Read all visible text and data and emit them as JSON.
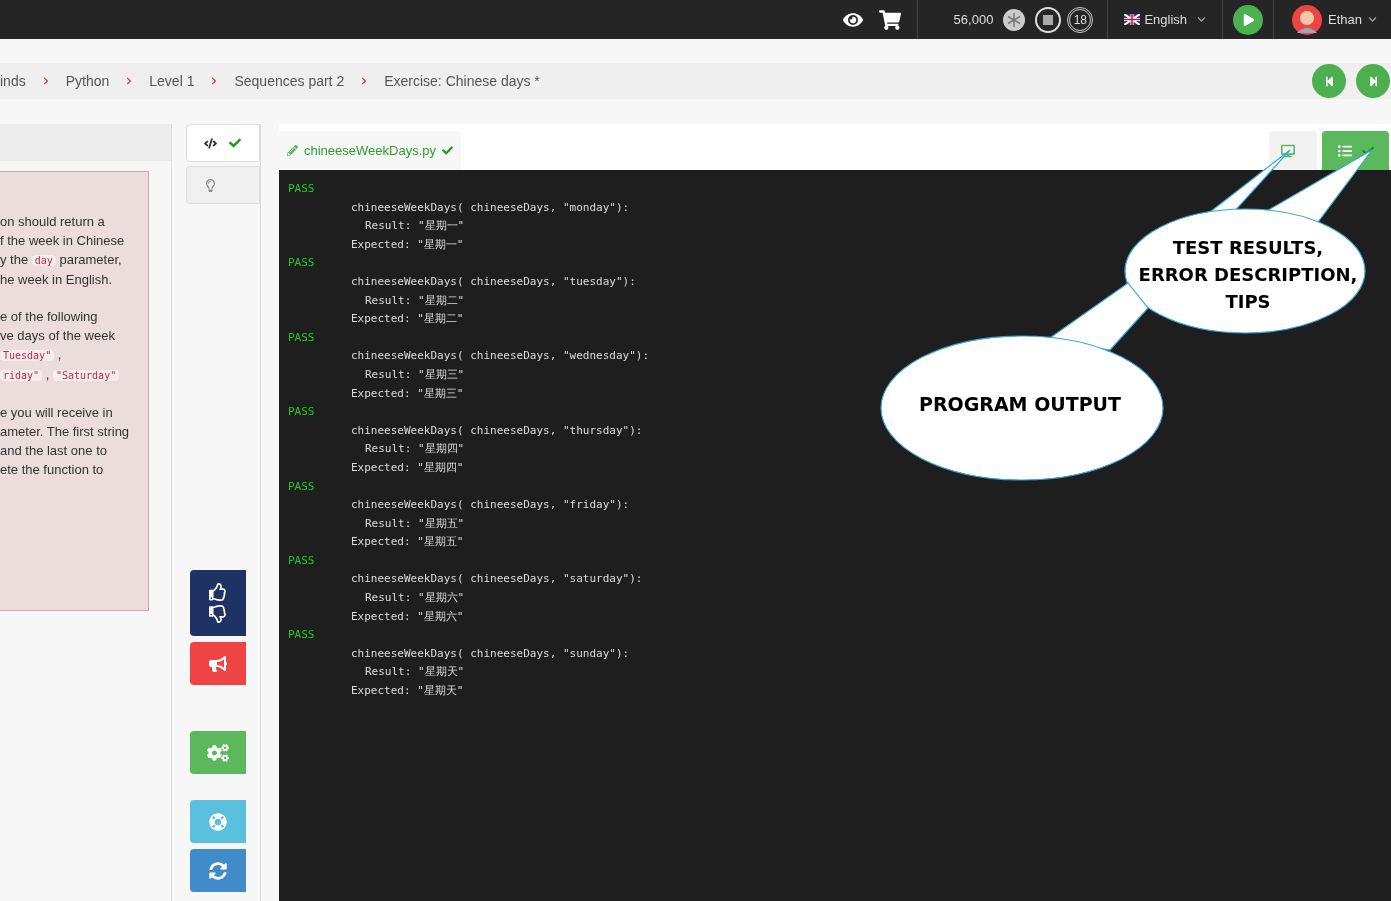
{
  "topbar": {
    "points": "56,000",
    "badge_count": "18",
    "language": "English",
    "user": "Ethan"
  },
  "breadcrumb": [
    "inds",
    "Python",
    "Level 1",
    "Sequences part 2",
    "Exercise: Chinese days *"
  ],
  "description": {
    "paragraphs": [
      [
        [
          {
            "kind": "text",
            "text": "on should return a"
          }
        ],
        [
          {
            "kind": "text",
            "text": "f the week in Chinese"
          }
        ],
        [
          {
            "kind": "text",
            "text": "y the "
          },
          {
            "kind": "code",
            "text": "day"
          },
          {
            "kind": "text",
            "text": " parameter,"
          }
        ],
        [
          {
            "kind": "text",
            "text": "he week in English."
          }
        ]
      ],
      [
        [
          {
            "kind": "text",
            "text": "e of the following"
          }
        ],
        [
          {
            "kind": "text",
            "text": "ve days of the week"
          }
        ],
        [
          {
            "kind": "code",
            "text": "Tuesday\""
          },
          {
            "kind": "text",
            "text": " ,"
          }
        ],
        [
          {
            "kind": "code",
            "text": "riday\""
          },
          {
            "kind": "text",
            "text": " , "
          },
          {
            "kind": "code",
            "text": "\"Saturday\""
          }
        ]
      ],
      [
        [
          {
            "kind": "text",
            "text": "e you will receive in"
          }
        ],
        [
          {
            "kind": "text",
            "text": "ameter. The first string"
          }
        ],
        [
          {
            "kind": "text",
            "text": "and the last one to"
          }
        ],
        [
          {
            "kind": "text",
            "text": "ete the function to"
          }
        ]
      ]
    ]
  },
  "side_tabs": [
    {
      "kind": "code",
      "selected": true,
      "checked": true
    },
    {
      "kind": "hint",
      "selected": false,
      "checked": false
    }
  ],
  "file_tab": {
    "name": "chineeseWeekDays.py",
    "checked": true
  },
  "view_tabs": [
    {
      "kind": "output",
      "selected": false,
      "checked": false
    },
    {
      "kind": "tests",
      "selected": true,
      "checked": true
    }
  ],
  "tests": [
    {
      "status": "PASS",
      "call": "chineeseWeekDays( chineeseDays, \"monday\"):",
      "result": "Result: \"星期一\"",
      "expected": "Expected: \"星期一\""
    },
    {
      "status": "PASS",
      "call": "chineeseWeekDays( chineeseDays, \"tuesday\"):",
      "result": "Result: \"星期二\"",
      "expected": "Expected: \"星期二\""
    },
    {
      "status": "PASS",
      "call": "chineeseWeekDays( chineeseDays, \"wednesday\"):",
      "result": "Result: \"星期三\"",
      "expected": "Expected: \"星期三\""
    },
    {
      "status": "PASS",
      "call": "chineeseWeekDays( chineeseDays, \"thursday\"):",
      "result": "Result: \"星期四\"",
      "expected": "Expected: \"星期四\""
    },
    {
      "status": "PASS",
      "call": "chineeseWeekDays( chineeseDays, \"friday\"):",
      "result": "Result: \"星期五\"",
      "expected": "Expected: \"星期五\""
    },
    {
      "status": "PASS",
      "call": "chineeseWeekDays( chineeseDays, \"saturday\"):",
      "result": "Result: \"星期六\"",
      "expected": "Expected: \"星期六\""
    },
    {
      "status": "PASS",
      "call": "chineeseWeekDays( chineeseDays, \"sunday\"):",
      "result": "Result: \"星期天\"",
      "expected": "Expected: \"星期天\""
    }
  ],
  "callouts": [
    {
      "lines": [
        "TEST RESULTS,",
        "ERROR DESCRIPTION,",
        "TIPS"
      ]
    },
    {
      "lines": [
        "PROGRAM OUTPUT"
      ]
    }
  ]
}
